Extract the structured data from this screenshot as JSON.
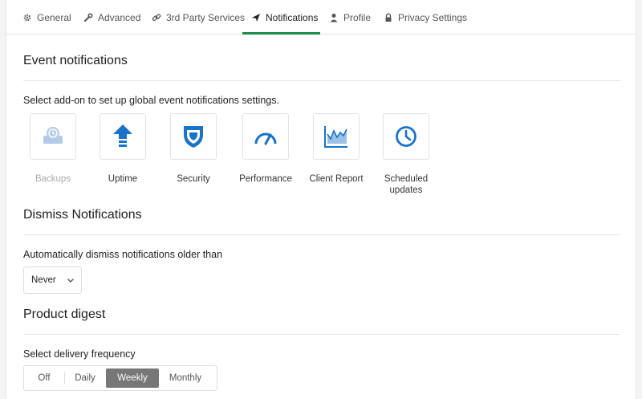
{
  "tabs": [
    {
      "label": "General",
      "icon": "gear-icon"
    },
    {
      "label": "Advanced",
      "icon": "wrench-icon"
    },
    {
      "label": "3rd Party Services",
      "icon": "link-icon"
    },
    {
      "label": "Notifications",
      "icon": "paper-plane-icon",
      "active": true
    },
    {
      "label": "Profile",
      "icon": "user-icon"
    },
    {
      "label": "Privacy Settings",
      "icon": "lock-icon"
    }
  ],
  "event_notifications": {
    "title": "Event notifications",
    "description": "Select add-on to set up global event notifications settings.",
    "addons": [
      {
        "label": "Backups",
        "icon": "backup-icon",
        "enabled": false
      },
      {
        "label": "Uptime",
        "icon": "uptime-arrow-icon",
        "enabled": true
      },
      {
        "label": "Security",
        "icon": "shield-icon",
        "enabled": true
      },
      {
        "label": "Performance",
        "icon": "gauge-icon",
        "enabled": true
      },
      {
        "label": "Client Report",
        "icon": "chart-icon",
        "enabled": true
      },
      {
        "label": "Scheduled updates",
        "icon": "clock-icon",
        "enabled": true
      }
    ]
  },
  "dismiss": {
    "title": "Dismiss Notifications",
    "description": "Automatically dismiss notifications older than",
    "selected": "Never"
  },
  "digest": {
    "title": "Product digest",
    "description": "Select delivery frequency",
    "options": [
      "Off",
      "Daily",
      "Weekly",
      "Monthly"
    ],
    "selected": "Weekly"
  },
  "colors": {
    "accent": "#1b8a4a",
    "icon_blue": "#1a73c7",
    "active_segment": "#777777"
  }
}
